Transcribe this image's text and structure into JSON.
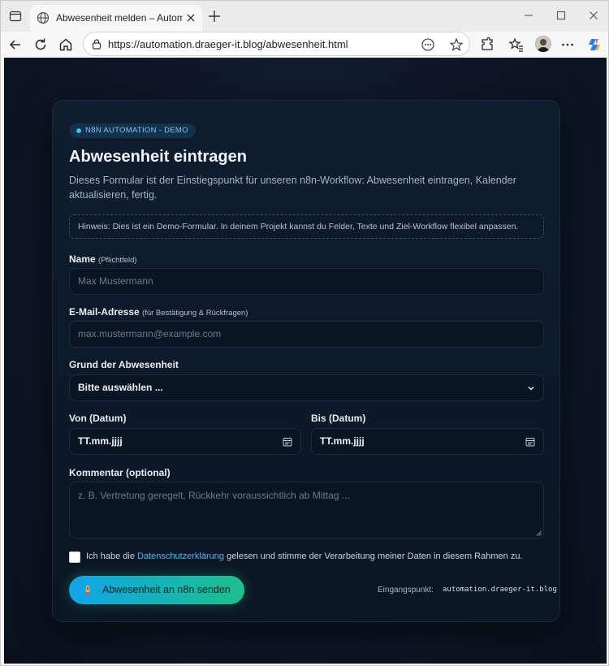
{
  "browser": {
    "tab_title": "Abwesenheit melden – Automatio",
    "url": "https://automation.draeger-it.blog/abwesenheit.html",
    "accent": "#0067c0"
  },
  "page": {
    "badge": "N8N AUTOMATION - DEMO",
    "title": "Abwesenheit eintragen",
    "subtitle": "Dieses Formular ist der Einstiegspunkt für unseren n8n-Workflow: Abwesenheit eintragen, Kalender aktualisieren, fertig.",
    "hint": "Hinweis: Dies ist ein Demo-Formular. In deinem Projekt kannst du Felder, Texte und Ziel-Workflow flexibel anpassen.",
    "name": {
      "label": "Name",
      "note": "(Pflichtfeld)",
      "placeholder": "Max Mustermann"
    },
    "email": {
      "label": "E-Mail-Adresse",
      "note": "(für Bestätigung & Rückfragen)",
      "placeholder": "max.mustermann@example.com"
    },
    "reason": {
      "label": "Grund der Abwesenheit",
      "selected": "Bitte auswählen ..."
    },
    "from": {
      "label": "Von (Datum)",
      "value": "TT.mm.jjjj"
    },
    "to": {
      "label": "Bis (Datum)",
      "value": "TT.mm.jjjj"
    },
    "comment": {
      "label": "Kommentar (optional)",
      "placeholder": "z. B. Vertretung geregelt, Rückkehr voraussichtlich ab Mittag ..."
    },
    "consent": {
      "before": "Ich habe die ",
      "link": "Datenschutzerklärung",
      "after": " gelesen und stimme der Verarbeitung meiner Daten in diesem Rahmen zu."
    },
    "submit_label": "Abwesenheit an n8n senden",
    "entry_label": "Eingangspunkt:",
    "entry_value": "automation.draeger-it.blog",
    "colors": {
      "accent_from": "#0ea5e9",
      "accent_to": "#1cc08a",
      "link": "#4cb6ef"
    }
  }
}
